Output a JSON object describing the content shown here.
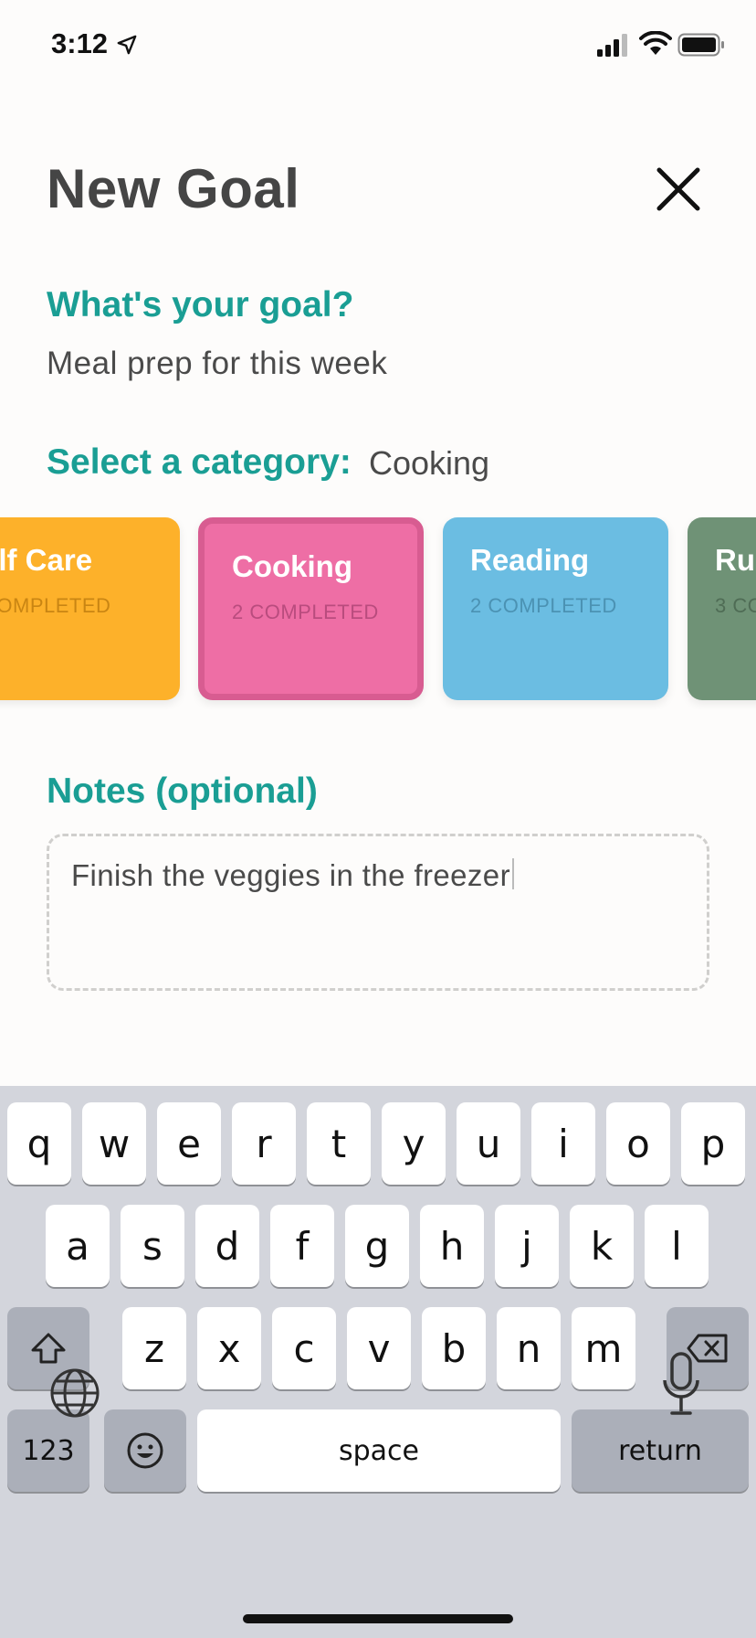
{
  "status": {
    "time": "3:12"
  },
  "header": {
    "title": "New Goal"
  },
  "goal": {
    "label": "What's your goal?",
    "value": "Meal prep for this week"
  },
  "category": {
    "label": "Select a category:",
    "selected": "Cooking",
    "items": [
      {
        "name": "elf Care",
        "count": "COMPLETED",
        "color": "#fdb12a"
      },
      {
        "name": "Cooking",
        "count": "2 COMPLETED",
        "color": "#ee6ea5"
      },
      {
        "name": "Reading",
        "count": "2 COMPLETED",
        "color": "#6bbde2"
      },
      {
        "name": "Rur",
        "count": "3 CO",
        "color": "#6f9276"
      }
    ]
  },
  "notes": {
    "label": "Notes (optional)",
    "value": "Finish the veggies in the freezer"
  },
  "keyboard": {
    "row1": [
      "q",
      "w",
      "e",
      "r",
      "t",
      "y",
      "u",
      "i",
      "o",
      "p"
    ],
    "row2": [
      "a",
      "s",
      "d",
      "f",
      "g",
      "h",
      "j",
      "k",
      "l"
    ],
    "row3": [
      "z",
      "x",
      "c",
      "v",
      "b",
      "n",
      "m"
    ],
    "numbers": "123",
    "space": "space",
    "return": "return"
  },
  "icons": [
    "location-arrow-icon",
    "cellular-signal-icon",
    "wifi-icon",
    "battery-icon",
    "close-icon",
    "shift-icon",
    "backspace-icon",
    "emoji-icon",
    "globe-icon",
    "microphone-icon"
  ]
}
